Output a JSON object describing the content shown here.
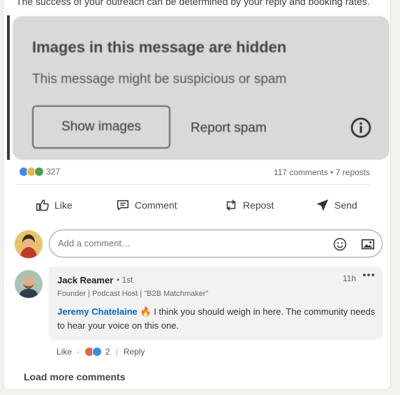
{
  "post": {
    "top_text": "The success of your outreach can be determined by your reply and booking rates.",
    "hidden_title": "Images in this message are hidden",
    "hidden_sub": "This message might be suspicious or spam",
    "show_images": "Show images",
    "report_spam": "Report spam"
  },
  "social": {
    "reactions_count": "327",
    "stats": "117 comments • 7 reposts",
    "actions": [
      {
        "label": "Like"
      },
      {
        "label": "Comment"
      },
      {
        "label": "Repost"
      },
      {
        "label": "Send"
      }
    ]
  },
  "compose": {
    "placeholder": "Add a comment…"
  },
  "comment": {
    "name": "Jack Reamer",
    "degree": "• 1st",
    "time": "11h",
    "more": "•••",
    "headline": "Founder | Podcast Host | \"B2B Matchmaker\"",
    "mention": "Jeremy Chatelaine",
    "emoji": "🔥",
    "text": " I think you should weigh in here. The community needs to hear your voice on this one.",
    "like": "Like",
    "sep1": "·",
    "reaction_count": "2",
    "sep2": "|",
    "reply": "Reply"
  },
  "footer": {
    "load_more": "Load more comments"
  },
  "colors": {
    "accent": "#0a66c2"
  }
}
